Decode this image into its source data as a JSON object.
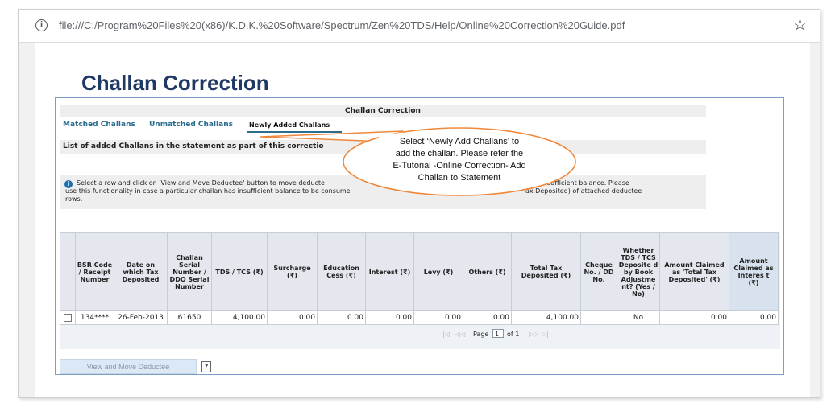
{
  "browser": {
    "url": "file:///C:/Program%20Files%20(x86)/K.D.K.%20Software/Spectrum/Zen%20TDS/Help/Online%20Correction%20Guide.pdf",
    "info_icon": "i",
    "star_icon": "☆"
  },
  "doc": {
    "title": "Challan Correction"
  },
  "app": {
    "panel_title": "Challan Correction",
    "tabs": [
      {
        "label": "Matched Challans"
      },
      {
        "label": "Unmatched Challans"
      },
      {
        "label": "Newly Added Challans"
      }
    ],
    "list_heading": "List of added Challans in the statement as part of this correctio",
    "info_icon": "i",
    "info": {
      "line1_left": "Select a row and click on 'View and Move Deductee' button to move deducte",
      "line1_right": "sufficient balance. Please",
      "line2_left": "use this functionality in case a particular challan has insufficient balance to be consume",
      "line2_right": "ax Deposited) of attached deductee",
      "line3": "rows."
    },
    "table": {
      "headers": [
        "",
        "BSR Code / Receipt Number",
        "Date on which Tax Deposited",
        "Challan Serial Number / DDO Serial Number",
        "TDS / TCS (₹)",
        "Surcharge (₹)",
        "Education Cess (₹)",
        "Interest (₹)",
        "Levy (₹)",
        "Others (₹)",
        "Total Tax Deposited (₹)",
        "Cheque No. / DD No.",
        "Whether TDS / TCS Deposite d by Book Adjustme nt? (Yes / No)",
        "Amount Claimed as 'Total Tax Deposited' (₹)",
        "Amount Claimed as 'Interes t' (₹)"
      ],
      "rows": [
        [
          "",
          "134****",
          "26-Feb-2013",
          "61650",
          "4,100.00",
          "0.00",
          "0.00",
          "0.00",
          "0.00",
          "0.00",
          "4,100.00",
          "",
          "No",
          "0.00",
          "0.00"
        ]
      ]
    },
    "pager": {
      "page_label": "Page",
      "page_value": "1",
      "of_label": "of 1",
      "first": "|◁",
      "prev": "◁◁",
      "next": "▷▷",
      "last": "▷|"
    },
    "view_move_button": "View and Move Deductee",
    "help_icon": "?"
  },
  "callout": {
    "line1": "Select ‘Newly Add Challans’ to",
    "line2": "add the challan. Please refer the",
    "line3": "E-Tutorial -Online Correction- Add",
    "line4": "Challan to Statement",
    "stroke_color": "#f0883a"
  }
}
